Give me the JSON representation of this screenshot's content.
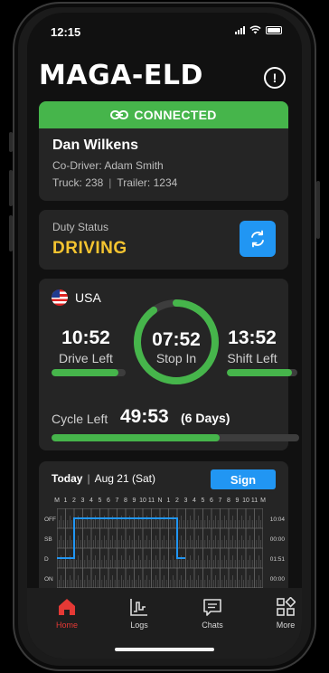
{
  "status_bar": {
    "time": "12:15"
  },
  "header": {
    "brand": "MAGA-ELD",
    "info_icon": "info-circle-icon"
  },
  "connection": {
    "label": "CONNECTED",
    "icon": "link-icon",
    "color": "#46b54b"
  },
  "driver": {
    "name": "Dan Wilkens",
    "codriver_label": "Co-Driver:",
    "codriver_name": "Adam Smith",
    "truck": "Truck: 238",
    "trailer": "Trailer: 1234"
  },
  "duty": {
    "label": "Duty Status",
    "value": "DRIVING",
    "value_color": "#f4c430",
    "refresh_icon": "refresh-icon"
  },
  "hours": {
    "country": "USA",
    "drive_left": {
      "time": "10:52",
      "label": "Drive Left",
      "progress": 0.9
    },
    "stop_in": {
      "time": "07:52",
      "label": "Stop In",
      "progress": 0.9
    },
    "shift_left": {
      "time": "13:52",
      "label": "Shift Left",
      "progress": 0.92
    },
    "cycle": {
      "label": "Cycle Left",
      "time": "49:53",
      "days": "(6 Days)",
      "progress": 0.68
    }
  },
  "log": {
    "today_label": "Today",
    "date": "Aug 21 (Sat)",
    "sign_label": "Sign",
    "hours": [
      "M",
      "1",
      "2",
      "3",
      "4",
      "5",
      "6",
      "7",
      "8",
      "9",
      "10",
      "11",
      "N",
      "1",
      "2",
      "3",
      "4",
      "5",
      "6",
      "7",
      "8",
      "9",
      "10",
      "11",
      "M"
    ],
    "rows": [
      {
        "label": "OFF",
        "total": "10:04"
      },
      {
        "label": "SB",
        "total": "00:00"
      },
      {
        "label": "D",
        "total": "01:51"
      },
      {
        "label": "ON",
        "total": "00:00"
      }
    ]
  },
  "nav": [
    {
      "label": "Home",
      "icon": "home-icon",
      "active": true
    },
    {
      "label": "Logs",
      "icon": "logs-chart-icon",
      "active": false
    },
    {
      "label": "Chats",
      "icon": "chat-icon",
      "active": false
    },
    {
      "label": "More",
      "icon": "more-grid-icon",
      "active": false
    }
  ],
  "colors": {
    "accent_blue": "#2196f3",
    "green": "#46b54b",
    "active_red": "#e53935"
  }
}
